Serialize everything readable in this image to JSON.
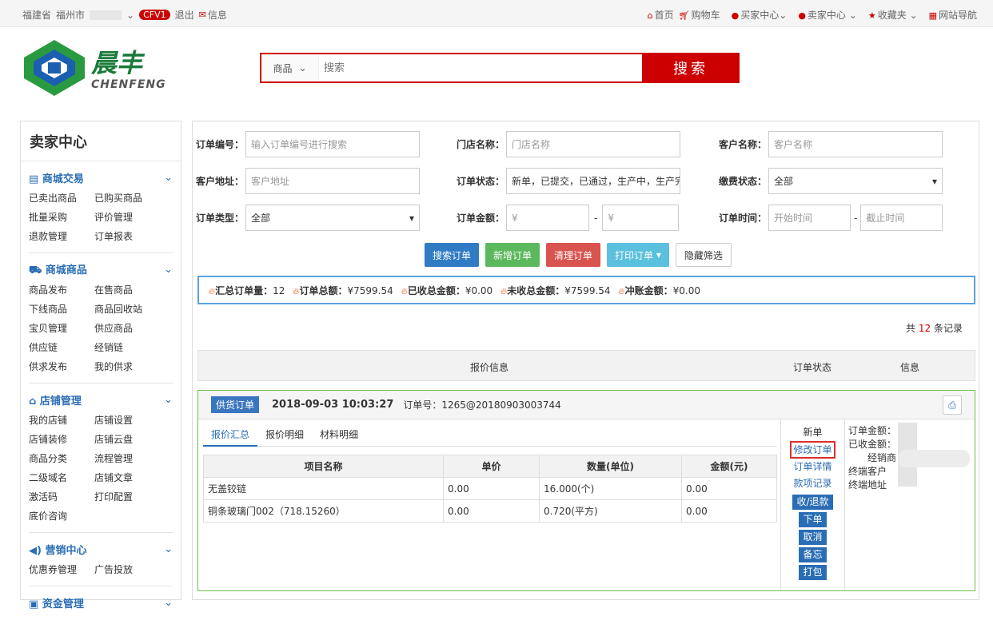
{
  "topbar": {
    "province": "福建省",
    "city": "福州市",
    "cfv": "CFV1",
    "logout": "退出",
    "message": "信息",
    "nav": [
      {
        "label": "首页",
        "icon": "home-icon"
      },
      {
        "label": "购物车",
        "icon": "cart-icon"
      },
      {
        "label": "买家中心",
        "icon": "user-icon"
      },
      {
        "label": "卖家中心",
        "icon": "user-icon"
      },
      {
        "label": "收藏夹",
        "icon": "star-icon"
      },
      {
        "label": "网站导航",
        "icon": "grid-icon"
      }
    ]
  },
  "logo": {
    "cn": "晨丰",
    "en": "CHENFENG"
  },
  "search": {
    "category": "商品",
    "placeholder": "搜索",
    "button": "搜索"
  },
  "sidebar": {
    "title": "卖家中心",
    "groups": [
      {
        "title": "商城交易",
        "icon": "list-icon",
        "items": [
          "已卖出商品",
          "已购买商品",
          "批量采购",
          "评价管理",
          "退款管理",
          "订单报表"
        ]
      },
      {
        "title": "商城商品",
        "icon": "truck-icon",
        "items": [
          "商品发布",
          "在售商品",
          "下线商品",
          "商品回收站",
          "宝贝管理",
          "供应商品",
          "供应链",
          "经销链",
          "供求发布",
          "我的供求"
        ]
      },
      {
        "title": "店铺管理",
        "icon": "home-icon",
        "items": [
          "我的店铺",
          "店铺设置",
          "店铺装修",
          "店铺云盘",
          "商品分类",
          "流程管理",
          "二级域名",
          "店铺文章",
          "激活码",
          "打印配置",
          "底价咨询"
        ]
      },
      {
        "title": "营销中心",
        "icon": "speaker-icon",
        "items": [
          "优惠券管理",
          "广告投放"
        ]
      },
      {
        "title": "资金管理",
        "icon": "money-icon",
        "items": []
      }
    ]
  },
  "filters": {
    "order_no": {
      "label": "订单编号：",
      "placeholder": "输入订单编号进行搜索"
    },
    "store": {
      "label": "门店名称：",
      "placeholder": "门店名称"
    },
    "customer": {
      "label": "客户名称：",
      "placeholder": "客户名称"
    },
    "address": {
      "label": "客户地址：",
      "placeholder": "客户地址"
    },
    "status": {
      "label": "订单状态：",
      "value": "新单，已提交，已通过，生产中，生产完"
    },
    "pay": {
      "label": "缴费状态：",
      "value": "全部"
    },
    "type": {
      "label": "订单类型：",
      "value": "全部"
    },
    "amount": {
      "label": "订单金额：",
      "ph1": "¥",
      "ph2": "¥"
    },
    "time": {
      "label": "订单时间：",
      "ph1": "开始时间",
      "ph2": "截止时间"
    },
    "dash": "-"
  },
  "buttons": {
    "search": "搜索订单",
    "add": "新增订单",
    "clear": "清理订单",
    "print": "打印订单",
    "hide": "隐藏筛选"
  },
  "summary": {
    "total_l": "汇总订单量：",
    "total_v": "12",
    "amount_l": "订单总额：",
    "amount_v": "¥7599.54",
    "received_l": "已收总金额：",
    "received_v": "¥0.00",
    "unreceived_l": "未收总金额：",
    "unreceived_v": "¥7599.54",
    "offset_l": "冲账金额：",
    "offset_v": "¥0.00"
  },
  "count": {
    "pre": "共",
    "n": "12",
    "post": "条记录"
  },
  "thead": {
    "c1": "报价信息",
    "c2": "订单状态",
    "c3": "信息"
  },
  "order": {
    "tag": "供货订单",
    "time": "2018-09-03 10:03:27",
    "no": "订单号：1265@20180903003744",
    "tabs": [
      "报价汇总",
      "报价明细",
      "材料明细"
    ],
    "cols": [
      "项目名称",
      "单价",
      "数量(单位)",
      "金额(元)"
    ],
    "rows": [
      [
        "无盖铰链",
        "0.00",
        "16.000(个)",
        "0.00"
      ],
      [
        "铜条玻璃门002（718.15260）",
        "0.00",
        "0.720(平方)",
        "0.00"
      ]
    ],
    "status": "新单",
    "edit": "修改订单",
    "detail": "订单详情",
    "payrec": "款项记录",
    "actions": [
      "收/退款",
      "下单",
      "取消",
      "备忘",
      "打包"
    ],
    "info": [
      "订单金额：",
      "已收金额：",
      "经销商",
      "终端客户",
      "终端地址"
    ]
  }
}
